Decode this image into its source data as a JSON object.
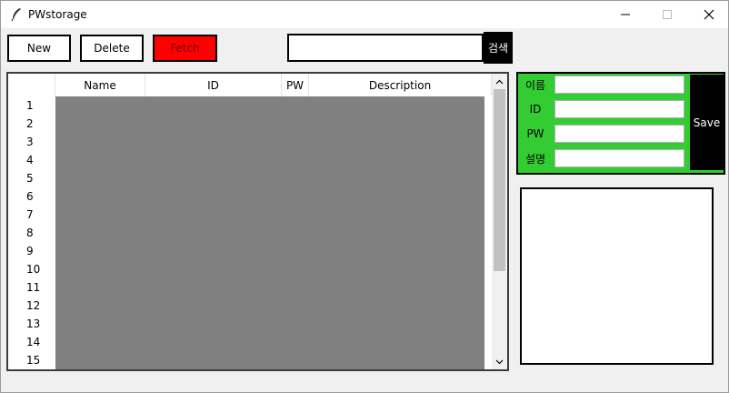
{
  "window": {
    "title": "PWstorage",
    "app_icon": "feather-icon",
    "controls": {
      "minimize": "minimize-icon",
      "maximize": "maximize-icon",
      "close": "close-icon"
    }
  },
  "toolbar": {
    "new_label": "New",
    "delete_label": "Delete",
    "fetch_label": "Fetch",
    "fetch_color": "#ff0000"
  },
  "search": {
    "value": "",
    "button_label": "검색"
  },
  "table": {
    "columns": [
      "Name",
      "ID",
      "PW",
      "Description"
    ],
    "row_numbers": [
      "1",
      "2",
      "3",
      "4",
      "5",
      "6",
      "7",
      "8",
      "9",
      "10",
      "11",
      "12",
      "13",
      "14",
      "15"
    ],
    "grid_color": "#808080"
  },
  "form": {
    "panel_color": "#33cc33",
    "name_label": "이름",
    "id_label": "ID",
    "pw_label": "PW",
    "desc_label": "설명",
    "name_value": "",
    "id_value": "",
    "pw_value": "",
    "desc_value": "",
    "save_label": "Save"
  }
}
